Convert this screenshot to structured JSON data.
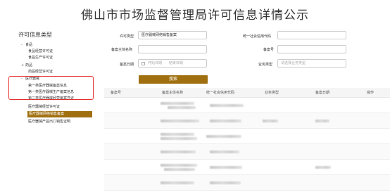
{
  "page": {
    "title": "佛山市市场监督管理局许可信息详情公示"
  },
  "sidebar": {
    "title": "许可信息类型",
    "items": [
      {
        "label": "食品",
        "toggle": "-"
      },
      {
        "label": "食品经营许可证"
      },
      {
        "label": "食品生产许可证"
      },
      {
        "label": "药品",
        "toggle": "+"
      },
      {
        "label": "药品经营许可证"
      },
      {
        "label": "医疗器械",
        "toggle": "-"
      },
      {
        "label": "第一类医疗器械备案信息"
      },
      {
        "label": "第一类医疗器械生产备案信息"
      },
      {
        "label": "第二类医疗器械经营备案凭证"
      },
      {
        "label": "医疗器械经营许可证"
      },
      {
        "label": "医疗器械网络销售备案"
      },
      {
        "label": "医疗器械产品出口销售证明"
      }
    ]
  },
  "form": {
    "license_type_label": "许可类型",
    "license_type_value": "医疗器械网络销售备案",
    "credit_code_label": "统一社会信用代码",
    "subject_name_label": "备案主体名称",
    "record_no_label": "备案号",
    "record_date_label": "备案日期",
    "start_date_placeholder": "开始日期",
    "date_sep": "-",
    "end_date_placeholder": "结束日期",
    "business_type_label": "业务类型",
    "business_type_placeholder": "请选择业务类型",
    "search_label": "搜索"
  },
  "table": {
    "headers": [
      "备案号",
      "备案主体名称",
      "统一社会信用代码",
      "业务类型",
      "备案日期",
      "操作"
    ],
    "row_count": 6
  },
  "colors": {
    "accent": "#a07010",
    "highlight": "#e53030"
  }
}
